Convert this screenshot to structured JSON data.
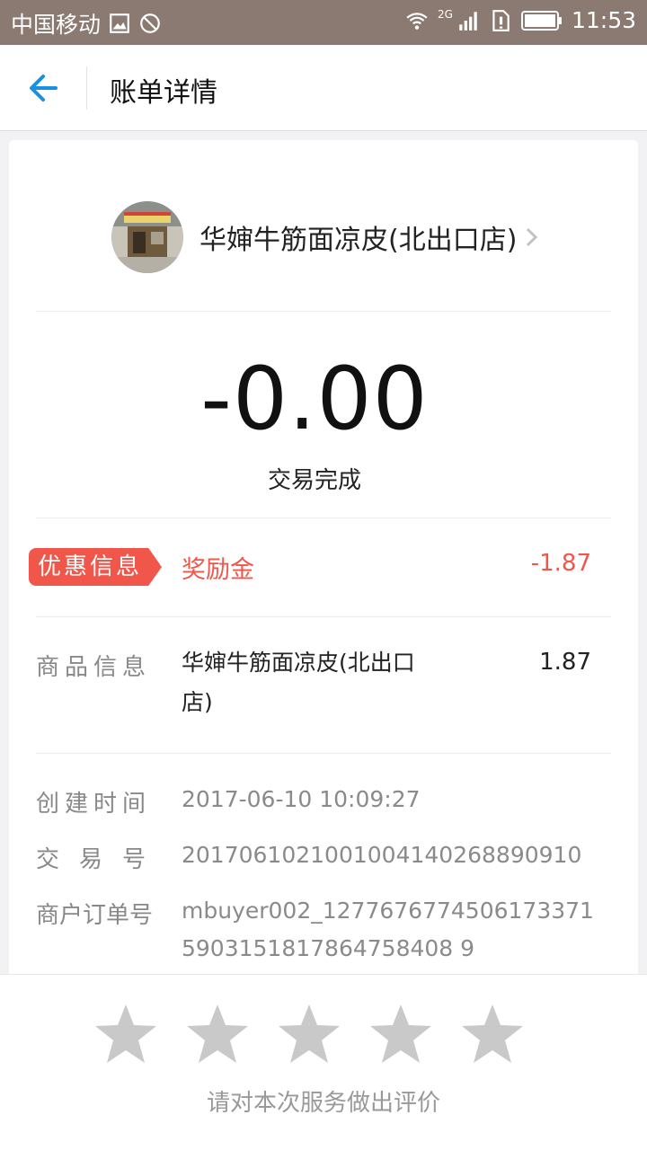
{
  "status_bar": {
    "carrier": "中国移动",
    "network": "2G",
    "time": "11:53"
  },
  "header": {
    "title": "账单详情"
  },
  "merchant": {
    "name": "华婶牛筋面凉皮(北出口店)"
  },
  "transaction": {
    "amount": "-0.00",
    "status": "交易完成"
  },
  "promotion": {
    "badge": "优惠信息",
    "name": "奖励金",
    "value": "-1.87"
  },
  "goods": {
    "label": "商品信息",
    "name_line1": "华婶牛筋面凉皮(北出口",
    "name_line2": "店)",
    "amount": "1.87"
  },
  "details": {
    "created_label": "创建时间",
    "created_value": "2017-06-10 10:09:27",
    "trade_no_label": "交易号",
    "trade_no_value": "2017061021001004140268890910",
    "order_no_label": "商户订单号",
    "order_no_line1": "mbuyer002_1277676774506173371",
    "order_no_line2": "5903151817864758408 9"
  },
  "rating": {
    "hint": "请对本次服务做出评价",
    "stars": 5
  },
  "colors": {
    "accent": "#f0574a",
    "back_arrow": "#1a8fe0",
    "star": "#c9c9c9"
  }
}
